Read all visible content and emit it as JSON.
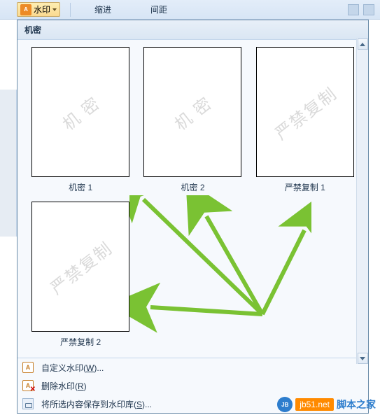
{
  "ribbon": {
    "watermark_btn_label": "水印",
    "indent_label": "缩进",
    "spacing_label": "间距"
  },
  "panel": {
    "section_header": "机密",
    "thumbs": [
      {
        "watermark_text": "机 密",
        "caption": "机密 1"
      },
      {
        "watermark_text": "机 密",
        "caption": "机密 2"
      },
      {
        "watermark_text": "严禁复制",
        "caption": "严禁复制 1"
      },
      {
        "watermark_text": "严禁复制",
        "caption": "严禁复制 2"
      }
    ],
    "menu": {
      "custom": "自定义水印(",
      "custom_key": "W",
      "custom_tail": ")...",
      "remove": "删除水印(",
      "remove_key": "R",
      "remove_tail": ")",
      "save": "将所选内容保存到水印库(",
      "save_key": "S",
      "save_tail": ")..."
    }
  },
  "site": {
    "badge": "JB",
    "url": "jb51.net",
    "name": "脚本之家"
  }
}
